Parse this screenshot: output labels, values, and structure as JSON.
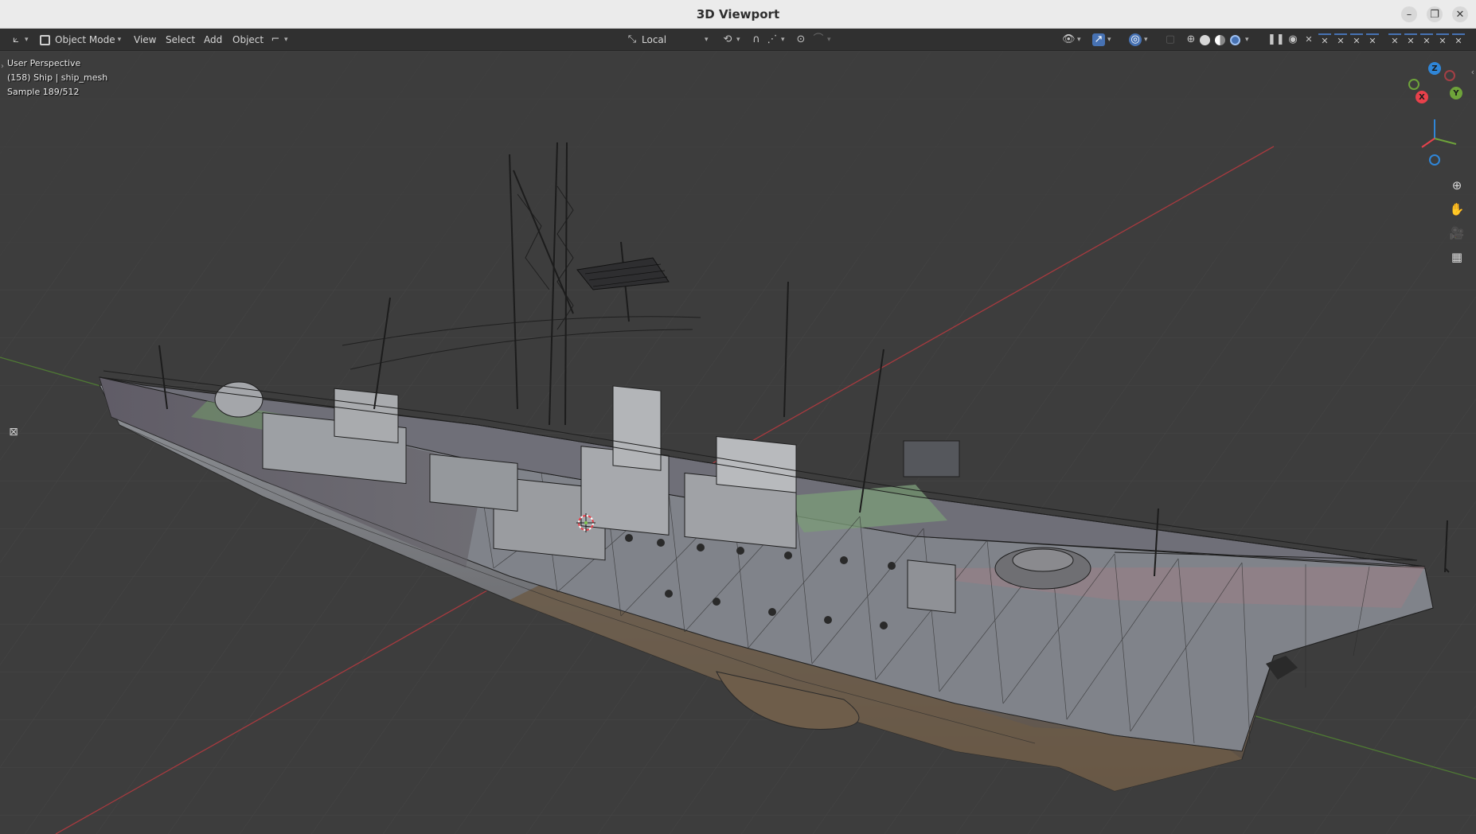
{
  "window": {
    "title": "3D Viewport",
    "controls": [
      "–",
      "❐",
      "✕"
    ]
  },
  "header": {
    "editor_type_icon": "axis-icon",
    "mode": "Object Mode",
    "menus": [
      "View",
      "Select",
      "Add",
      "Object"
    ],
    "transform_orientation": "Local"
  },
  "viewport": {
    "info": {
      "perspective": "User Perspective",
      "object": "(158) Ship | ship_mesh",
      "sample": "Sample 189/512"
    },
    "gizmo": {
      "x_label": "X",
      "y_label": "Y",
      "z_label": "Z"
    },
    "navigation_icons": [
      "zoom-icon",
      "hand-pan-icon",
      "camera-icon",
      "grid-icon"
    ],
    "colors": {
      "x_axis": "#e8414b",
      "y_axis": "#6ea33a",
      "z_axis": "#2f86d8",
      "background": "#3d3d3d",
      "active_button": "#4772b3"
    }
  }
}
